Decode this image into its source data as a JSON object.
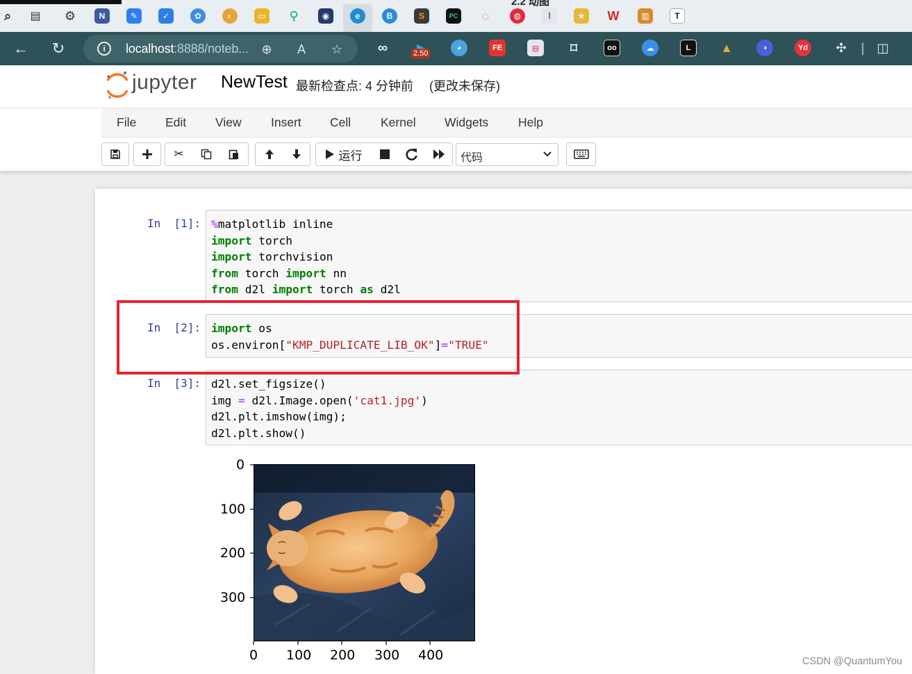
{
  "taskbar": {
    "pinned_title": "2.2 动图",
    "icons": [
      "search-icon",
      "task-view-icon",
      "settings-icon",
      "notion-icon",
      "todo-app-icon",
      "todo-check-icon",
      "colorful-app-icon",
      "chrome-like-icon",
      "file-explorer-icon",
      "search-app-icon",
      "github-icon",
      "edge-icon",
      "bing-icon",
      "sublime-icon",
      "pycharm-icon",
      "jupyter-icon",
      "netease-music-icon",
      "chart-app-icon",
      "sticker-app-icon",
      "wps-icon",
      "archive-icon",
      "typora-icon"
    ]
  },
  "browser": {
    "url_host": "localhost",
    "url_rest": ":8888/noteb...",
    "extension_badge": "2.50",
    "extension_fe_label": "FE",
    "extension_yd_label": "Yd",
    "extension_l_label": "L"
  },
  "jupyter": {
    "logo_text": "jupyter",
    "notebook_name": "NewTest",
    "checkpoint": "最新检查点: 4 分钟前",
    "autosave": "(更改未保存)",
    "menu": [
      "File",
      "Edit",
      "View",
      "Insert",
      "Cell",
      "Kernel",
      "Widgets",
      "Help"
    ],
    "toolbar": {
      "run_label": "运行",
      "cell_type": "代码"
    }
  },
  "cells": [
    {
      "prompt": "In  [1]:",
      "lines": [
        [
          [
            "mg",
            "%"
          ],
          [
            "",
            "matplotlib inline"
          ]
        ],
        [
          [
            "kw",
            "import"
          ],
          [
            "",
            " torch"
          ]
        ],
        [
          [
            "kw",
            "import"
          ],
          [
            "",
            " torchvision"
          ]
        ],
        [
          [
            "kw",
            "from"
          ],
          [
            "",
            " torch "
          ],
          [
            "kw",
            "import"
          ],
          [
            "",
            " nn"
          ]
        ],
        [
          [
            "kw",
            "from"
          ],
          [
            "",
            " d2l "
          ],
          [
            "kw",
            "import"
          ],
          [
            "",
            " torch "
          ],
          [
            "kw",
            "as"
          ],
          [
            "",
            " d2l"
          ]
        ]
      ]
    },
    {
      "prompt": "In  [2]:",
      "lines": [
        [
          [
            "kw",
            "import"
          ],
          [
            "",
            " os"
          ]
        ],
        [
          [
            "",
            "os.environ["
          ],
          [
            "str",
            "\"KMP_DUPLICATE_LIB_OK\""
          ],
          [
            "",
            "]"
          ],
          [
            "op",
            "="
          ],
          [
            "str",
            "\"TRUE\""
          ]
        ]
      ]
    },
    {
      "prompt": "In  [3]:",
      "lines": [
        [
          [
            "",
            "d2l.set_figsize()"
          ]
        ],
        [
          [
            "",
            "img "
          ],
          [
            "op",
            "="
          ],
          [
            "",
            " d2l.Image.open("
          ],
          [
            "str",
            "'cat1.jpg'"
          ],
          [
            "",
            ")"
          ]
        ],
        [
          [
            "",
            "d2l.plt.imshow(img);"
          ]
        ],
        [
          [
            "",
            "d2l.plt.show()"
          ]
        ]
      ]
    }
  ],
  "chart_data": {
    "type": "image",
    "title": "",
    "image_subject": "orange tabby cat lying on its back",
    "y_ticks": [
      "0",
      "100",
      "200",
      "300"
    ],
    "x_ticks": [
      "0",
      "100",
      "200",
      "300",
      "400"
    ]
  },
  "watermark": "CSDN @QuantumYou"
}
